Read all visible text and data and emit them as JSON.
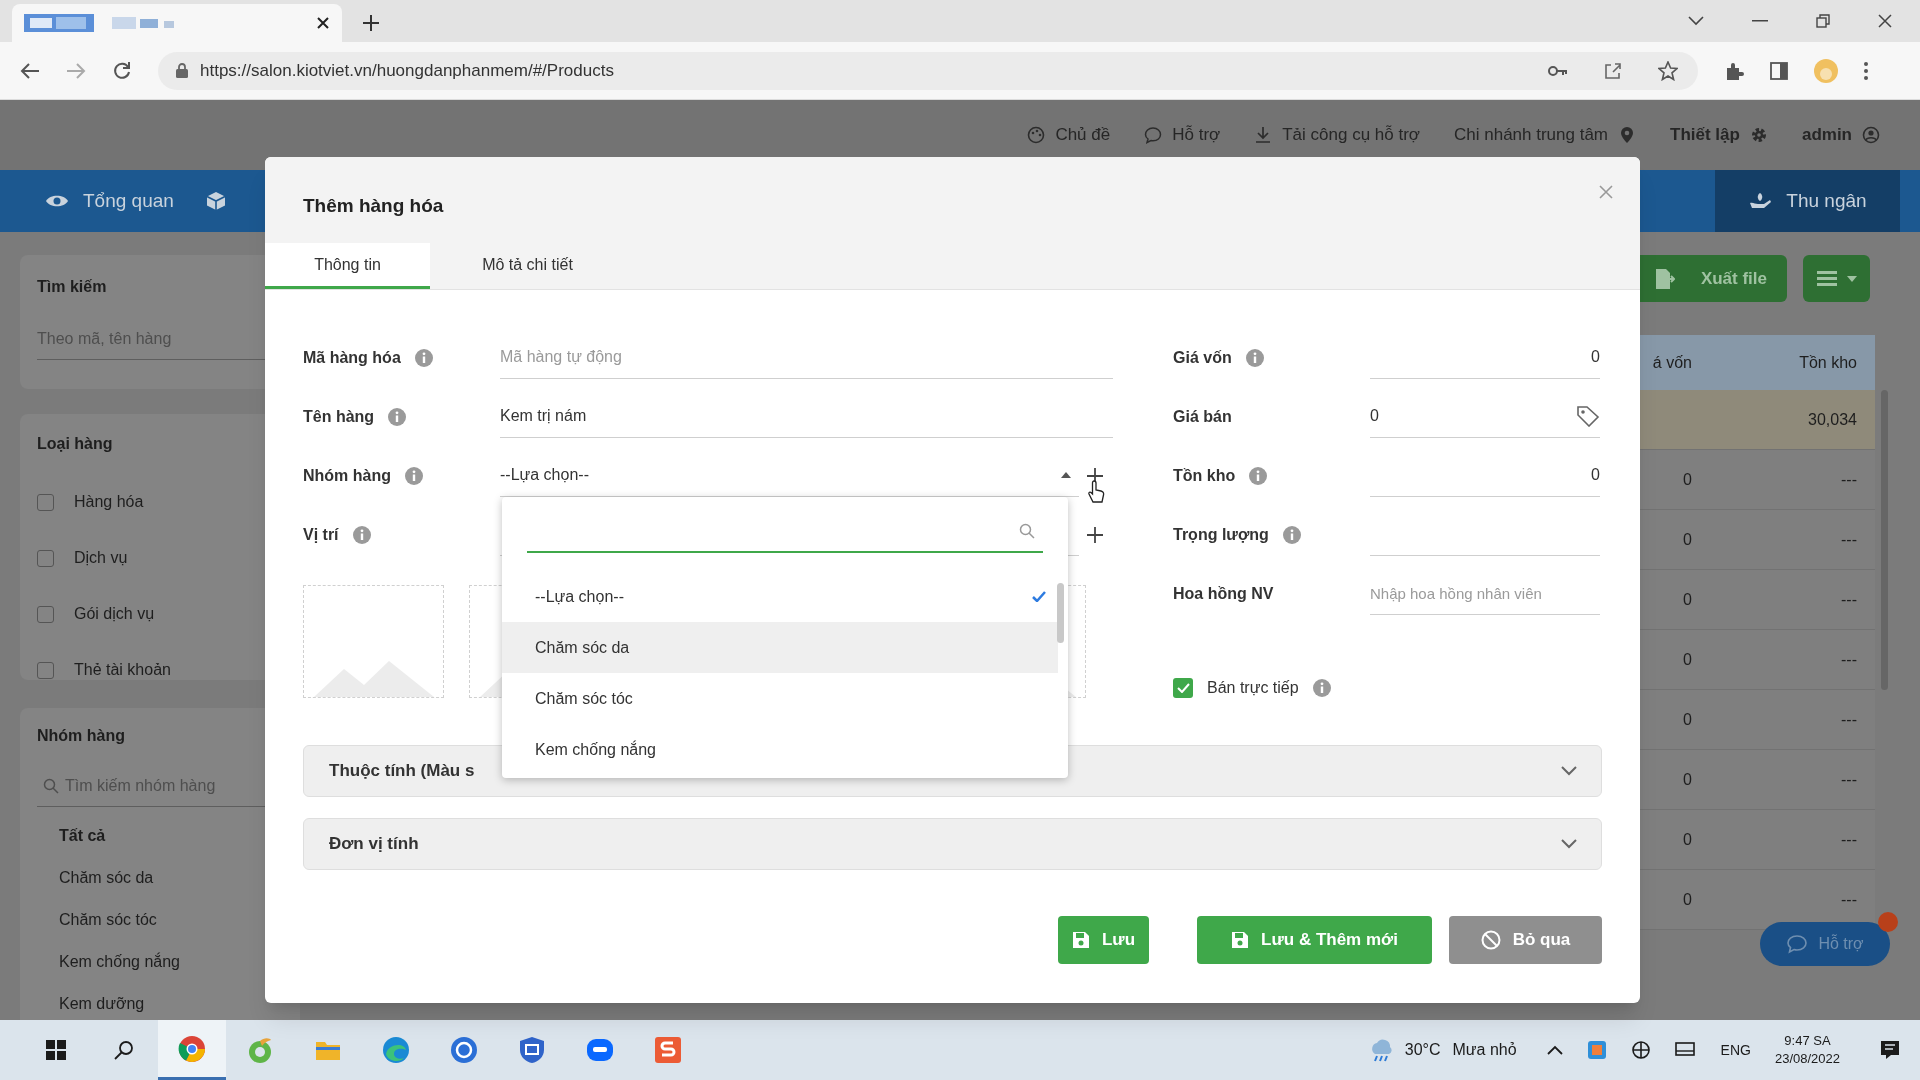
{
  "browser": {
    "url": "https://salon.kiotviet.vn/huongdanphanmem/#/Products"
  },
  "app_header": {
    "items": [
      {
        "label": "Chủ đề",
        "bold": false
      },
      {
        "label": "Hỗ trợ",
        "bold": false
      },
      {
        "label": "Tải công cụ hỗ trợ",
        "bold": false
      },
      {
        "label": "Chi nhánh trung tâm",
        "bold": false
      },
      {
        "label": "Thiết lập",
        "bold": true
      },
      {
        "label": "admin",
        "bold": true
      }
    ]
  },
  "nav": {
    "items": [
      "Tổng quan"
    ],
    "cashier": "Thu ngân"
  },
  "sidebar": {
    "search": {
      "title": "Tìm kiếm",
      "placeholder": "Theo mã, tên hàng"
    },
    "types": {
      "title": "Loại hàng",
      "items": [
        {
          "label": "Hàng hóa",
          "checked": false
        },
        {
          "label": "Dịch vụ",
          "checked": false
        },
        {
          "label": "Gói dịch vụ",
          "checked": false
        },
        {
          "label": "Thẻ tài khoản",
          "checked": false
        }
      ]
    },
    "groups": {
      "title": "Nhóm hàng",
      "placeholder": "Tìm kiếm nhóm hàng",
      "items": [
        {
          "label": "Tất cả",
          "selected": true
        },
        {
          "label": "Chăm sóc da",
          "selected": false
        },
        {
          "label": "Chăm sóc tóc",
          "selected": false
        },
        {
          "label": "Kem chống nắng",
          "selected": false
        },
        {
          "label": "Kem dưỡng",
          "selected": false
        }
      ]
    }
  },
  "toolbar": {
    "export": "Xuất file"
  },
  "table": {
    "columns": [
      "á vốn",
      "Tồn kho"
    ],
    "rows": [
      {
        "stock": "30,034",
        "selected": true
      },
      {
        "cost": "0",
        "stock": "---",
        "selected": false
      },
      {
        "cost": "0",
        "stock": "---",
        "selected": false
      },
      {
        "cost": "0",
        "stock": "---",
        "selected": false
      },
      {
        "cost": "0",
        "stock": "---",
        "selected": false
      },
      {
        "cost": "0",
        "stock": "---",
        "selected": false
      },
      {
        "cost": "0",
        "stock": "---",
        "selected": false
      },
      {
        "cost": "0",
        "stock": "---",
        "selected": false
      },
      {
        "cost": "0",
        "stock": "---",
        "selected": false
      }
    ]
  },
  "chat_button": "Hỗ trợ",
  "modal": {
    "title": "Thêm hàng hóa",
    "tabs": [
      {
        "label": "Thông tin",
        "selected": true
      },
      {
        "label": "Mô tả chi tiết",
        "selected": false
      }
    ],
    "left_fields": [
      {
        "kind": "text",
        "label": "Mã hàng hóa",
        "info": true,
        "placeholder": "Mã hàng tự động"
      },
      {
        "kind": "text",
        "label": "Tên hàng",
        "info": true,
        "value": "Kem trị nám"
      },
      {
        "kind": "select",
        "label": "Nhóm hàng",
        "info": true,
        "value": "--Lựa chọn--",
        "expanded": true
      },
      {
        "kind": "select",
        "label": "Vị trí",
        "info": true,
        "expanded": false
      }
    ],
    "right_fields": [
      {
        "kind": "number",
        "label": "Giá vốn",
        "info": true,
        "value": "0"
      },
      {
        "kind": "price",
        "label": "Giá bán",
        "value": "0"
      },
      {
        "kind": "number",
        "label": "Tồn kho",
        "info": true,
        "value": "0"
      },
      {
        "kind": "number",
        "label": "Trọng lượng",
        "info": true
      },
      {
        "kind": "text",
        "label": "Hoa hồng NV",
        "placeholder": "Nhập hoa hồng nhân viên"
      }
    ],
    "direct_sale": {
      "label": "Bán trực tiếp",
      "checked": true,
      "info": true
    },
    "sections": [
      {
        "label": "Thuộc tính (Màu s"
      },
      {
        "label": "Đơn vị tính"
      }
    ],
    "dropdown": {
      "options": [
        {
          "label": "--Lựa chọn--",
          "selected": true,
          "hovered": false
        },
        {
          "label": "Chăm sóc da",
          "selected": false,
          "hovered": true
        },
        {
          "label": "Chăm sóc tóc",
          "selected": false,
          "hovered": false
        },
        {
          "label": "Kem chống nắng",
          "selected": false,
          "hovered": false
        }
      ]
    },
    "buttons": [
      {
        "label": "Lưu",
        "kind": "primary"
      },
      {
        "label": "Lưu & Thêm mới",
        "kind": "primary"
      },
      {
        "label": "Bỏ qua",
        "kind": "secondary"
      }
    ]
  },
  "taskbar": {
    "temperature": "30°C",
    "weather": "Mưa nhỏ",
    "language": "ENG",
    "time": "9:47 SA",
    "date": "23/08/2022"
  }
}
